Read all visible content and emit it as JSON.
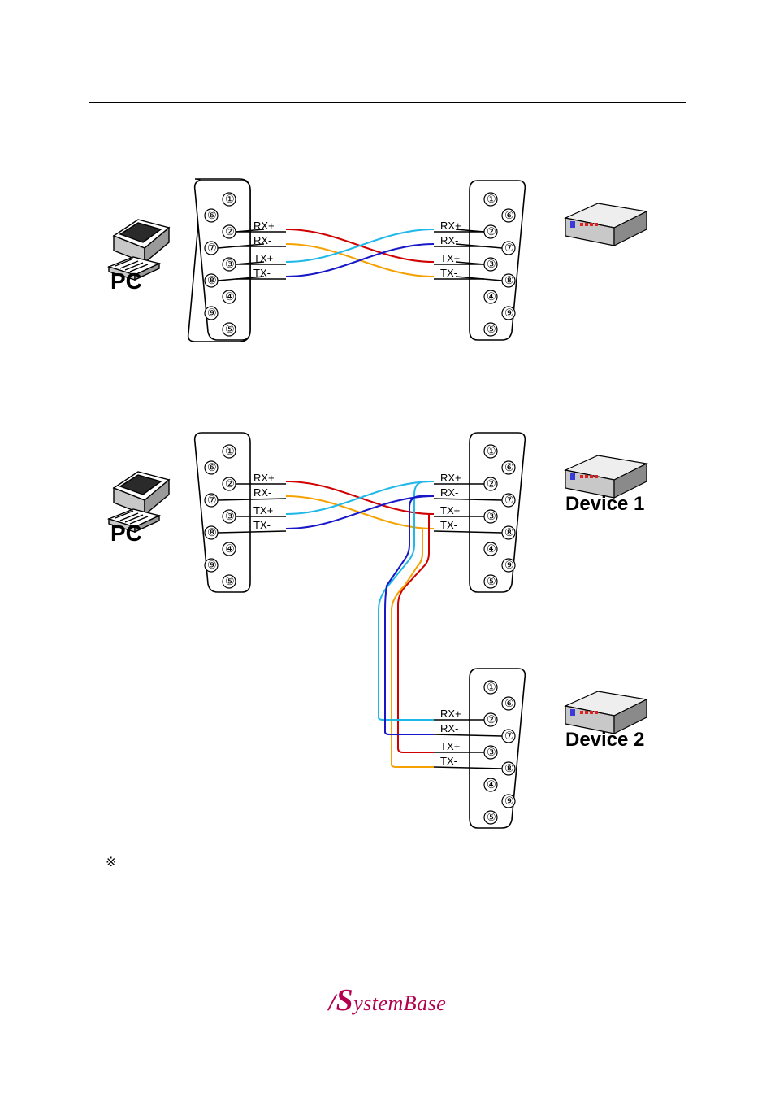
{
  "pins": [
    "①",
    "②",
    "③",
    "④",
    "⑤",
    "⑥",
    "⑦",
    "⑧",
    "⑨"
  ],
  "signals": {
    "rxp": "RX+",
    "rxm": "RX-",
    "txp": "TX+",
    "txm": "TX-"
  },
  "labels": {
    "pc": "PC",
    "dev1": "Device 1",
    "dev2": "Device 2"
  },
  "footnote_marker": "※",
  "logo": {
    "slash": "/",
    "s": "S",
    "rest": "ystemBase"
  }
}
